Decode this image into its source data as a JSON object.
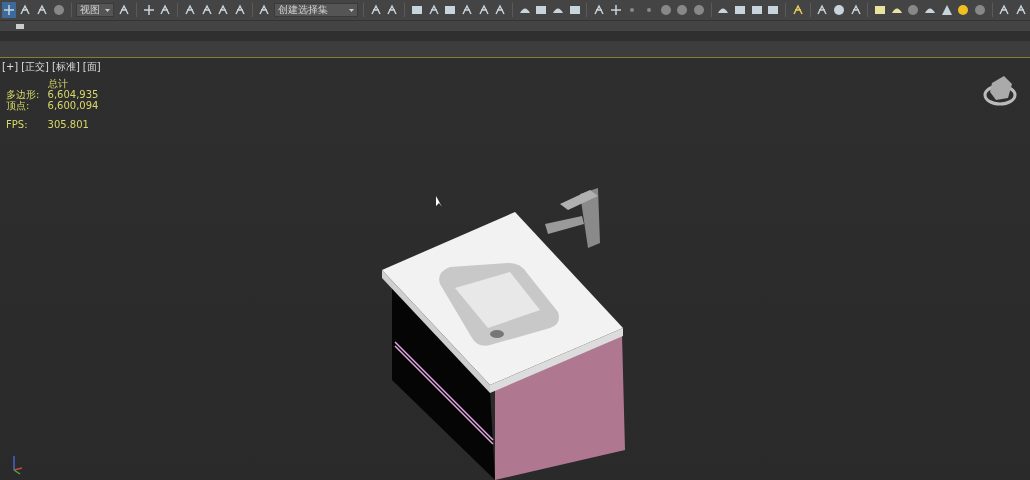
{
  "toolbar": {
    "view_dropdown": {
      "value": "视图"
    },
    "selection_set_dropdown": {
      "value": "创建选择集"
    }
  },
  "viewport": {
    "labels": [
      "[+]",
      "[正交]",
      "[标准]",
      "[面]"
    ],
    "stats": {
      "title": "总计",
      "rows": [
        {
          "label": "多边形:",
          "value": "6,604,935"
        },
        {
          "label": "顶点:",
          "value": "6,600,094"
        }
      ],
      "fps_label": "FPS:",
      "fps_value": "305.801"
    }
  }
}
